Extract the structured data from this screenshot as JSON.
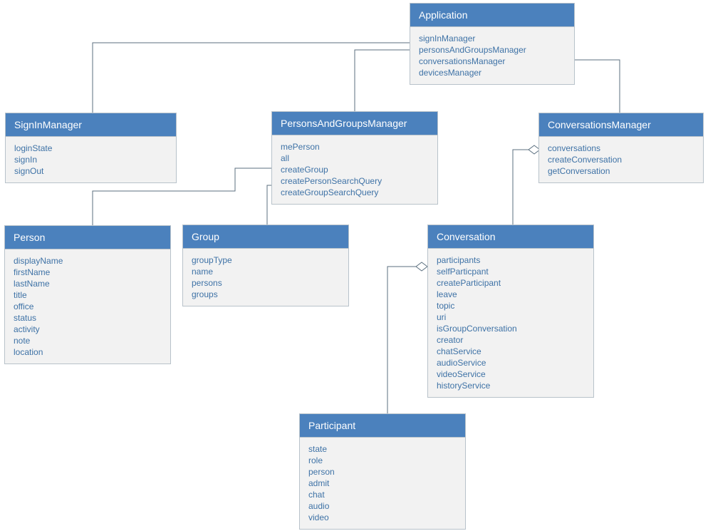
{
  "classes": {
    "application": {
      "title": "Application",
      "members": [
        "signInManager",
        "personsAndGroupsManager",
        "conversationsManager",
        "devicesManager"
      ]
    },
    "signInManager": {
      "title": "SignInManager",
      "members": [
        "loginState",
        "signIn",
        "signOut"
      ]
    },
    "personsAndGroupsManager": {
      "title": "PersonsAndGroupsManager",
      "members": [
        "mePerson",
        "all",
        "createGroup",
        "createPersonSearchQuery",
        "createGroupSearchQuery"
      ]
    },
    "conversationsManager": {
      "title": "ConversationsManager",
      "members": [
        "conversations",
        "createConversation",
        "getConversation"
      ]
    },
    "person": {
      "title": "Person",
      "members": [
        "displayName",
        "firstName",
        "lastName",
        "title",
        "office",
        "status",
        "activity",
        "note",
        "location"
      ]
    },
    "group": {
      "title": "Group",
      "members": [
        "groupType",
        "name",
        "persons",
        "groups"
      ]
    },
    "conversation": {
      "title": "Conversation",
      "members": [
        "participants",
        "selfParticpant",
        "createParticipant",
        "leave",
        "topic",
        "uri",
        "isGroupConversation",
        "creator",
        "chatService",
        "audioService",
        "videoService",
        "historyService"
      ]
    },
    "participant": {
      "title": "Participant",
      "members": [
        "state",
        "role",
        "person",
        "admit",
        "chat",
        "audio",
        "video"
      ]
    }
  }
}
